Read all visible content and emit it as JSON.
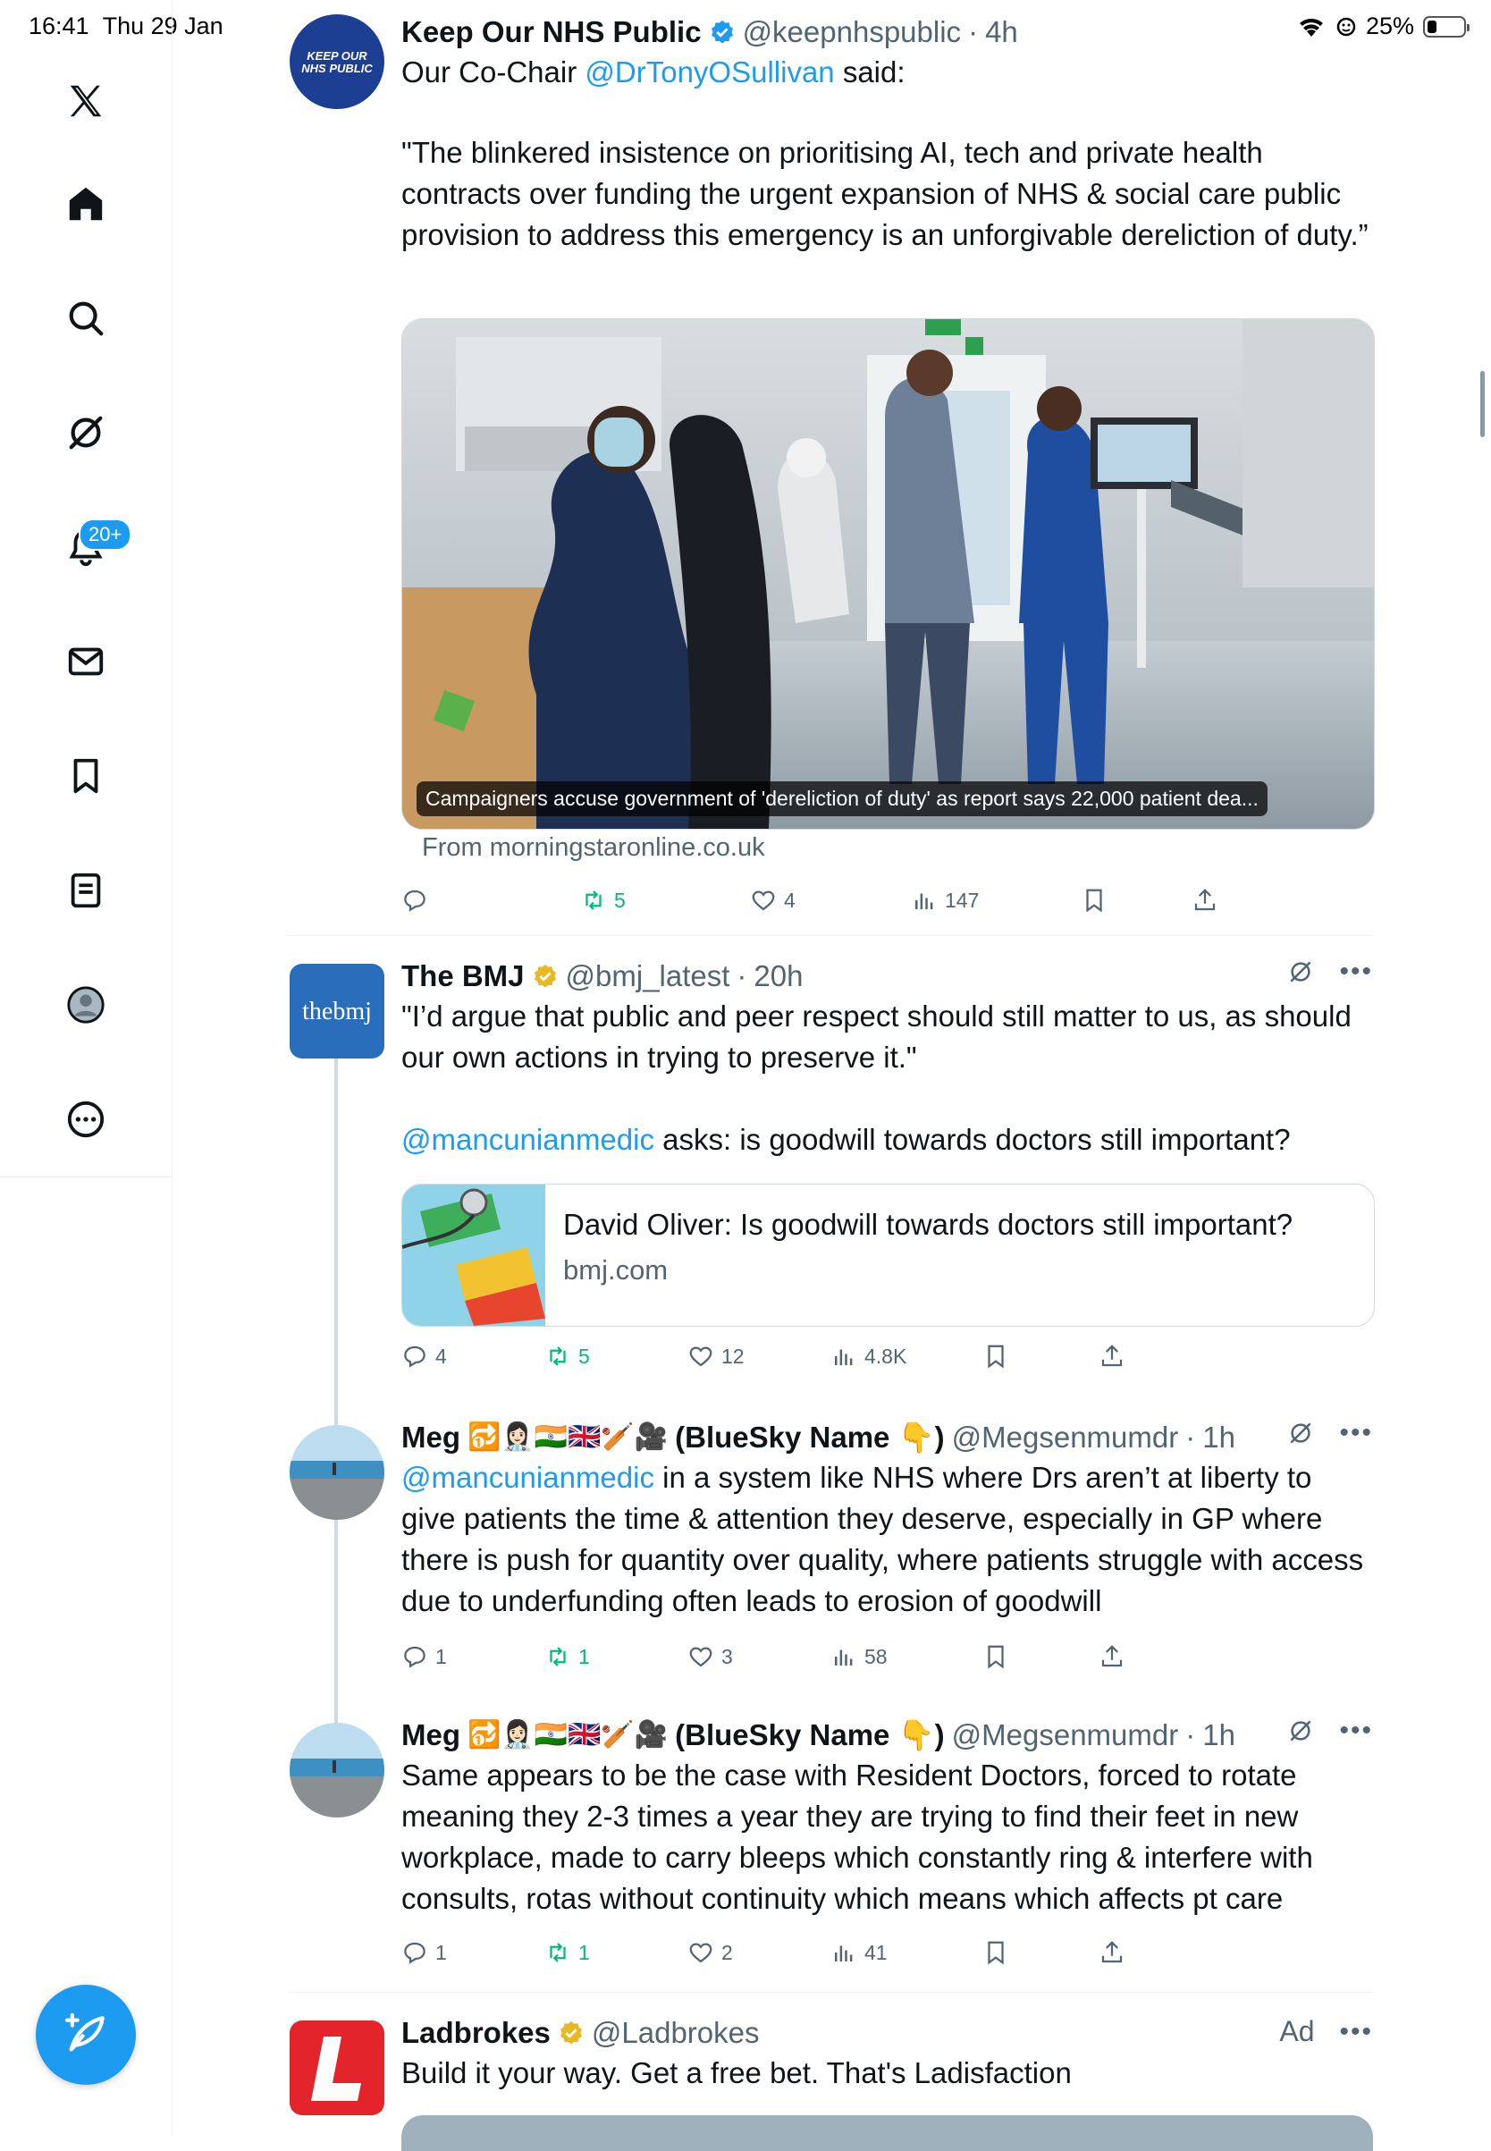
{
  "status_bar": {
    "time": "16:41",
    "date": "Thu 29 Jan",
    "battery": "25%",
    "battery_level": 0.25
  },
  "sidebar": {
    "items": [
      "x-logo",
      "home-icon",
      "search-icon",
      "grok-icon",
      "notifications-icon",
      "messages-icon",
      "bookmarks-icon",
      "lists-icon",
      "profile-icon",
      "more-icon"
    ],
    "notifications_badge": "20+"
  },
  "colors": {
    "accent": "#1d9bf0",
    "repost_green": "#00ba7c",
    "verified_gold": "#e8b923",
    "muted": "#536471"
  },
  "tweets": [
    {
      "avatar_text": "KEEP OUR NHS PUBLIC",
      "name": "Keep Our NHS Public",
      "handle": "@keepnhspublic",
      "time": "4h",
      "text_prefix": "Our Co-Chair ",
      "mention": "@DrTonyOSullivan",
      "text_suffix": " said:",
      "quote": "\"The blinkered insistence on prioritising AI, tech and private health contracts over funding the urgent expansion of NHS & social care public provision to address this emergency is an unforgivable dereliction of duty.”",
      "media_caption": "Campaigners accuse government of 'dereliction of duty' as report says 22,000 patient dea...",
      "from": "From morningstaronline.co.uk",
      "replies": "",
      "reposts": "5",
      "likes": "4",
      "views": "147"
    },
    {
      "avatar_text": "thebmj",
      "name": "The BMJ",
      "handle": "@bmj_latest",
      "time": "20h",
      "text": "\"I’d argue that public and peer respect should still matter to us, as should our own actions in trying to preserve it.\"",
      "mention": "@mancunianmedic",
      "text_suffix": " asks: is goodwill towards doctors still important?",
      "link_title": "David Oliver: Is goodwill towards doctors still important?",
      "link_domain": "bmj.com",
      "replies": "4",
      "reposts": "5",
      "likes": "12",
      "views": "4.8K"
    },
    {
      "name": "Meg",
      "name_emojis": "🔂👩🏻‍⚕️🇮🇳🇬🇧🏏🎥",
      "name_suffix": "(BlueSky Name 👇)",
      "handle": "@Megsenmumdr",
      "time": "1h",
      "mention": "@mancunianmedic",
      "text": " in a system like NHS where Drs aren’t at liberty to give patients the time & attention they deserve, especially in GP where there is push for quantity over quality, where patients struggle with access due to underfunding often leads to erosion of goodwill",
      "replies": "1",
      "reposts": "1",
      "likes": "3",
      "views": "58"
    },
    {
      "name": "Meg",
      "name_emojis": "🔂👩🏻‍⚕️🇮🇳🇬🇧🏏🎥",
      "name_suffix": "(BlueSky Name 👇)",
      "handle": "@Megsenmumdr",
      "time": "1h",
      "text": "Same appears to be the case with Resident Doctors, forced to rotate meaning they 2-3 times a year they are trying to find their feet in new workplace, made to carry bleeps which constantly ring & interfere with consults, rotas without continuity which means which affects pt care",
      "replies": "1",
      "reposts": "1",
      "likes": "2",
      "views": "41"
    },
    {
      "name": "Ladbrokes",
      "handle": "@Ladbrokes",
      "ad_label": "Ad",
      "text": "Build it your way. Get a free bet. That's Ladisfaction"
    }
  ]
}
